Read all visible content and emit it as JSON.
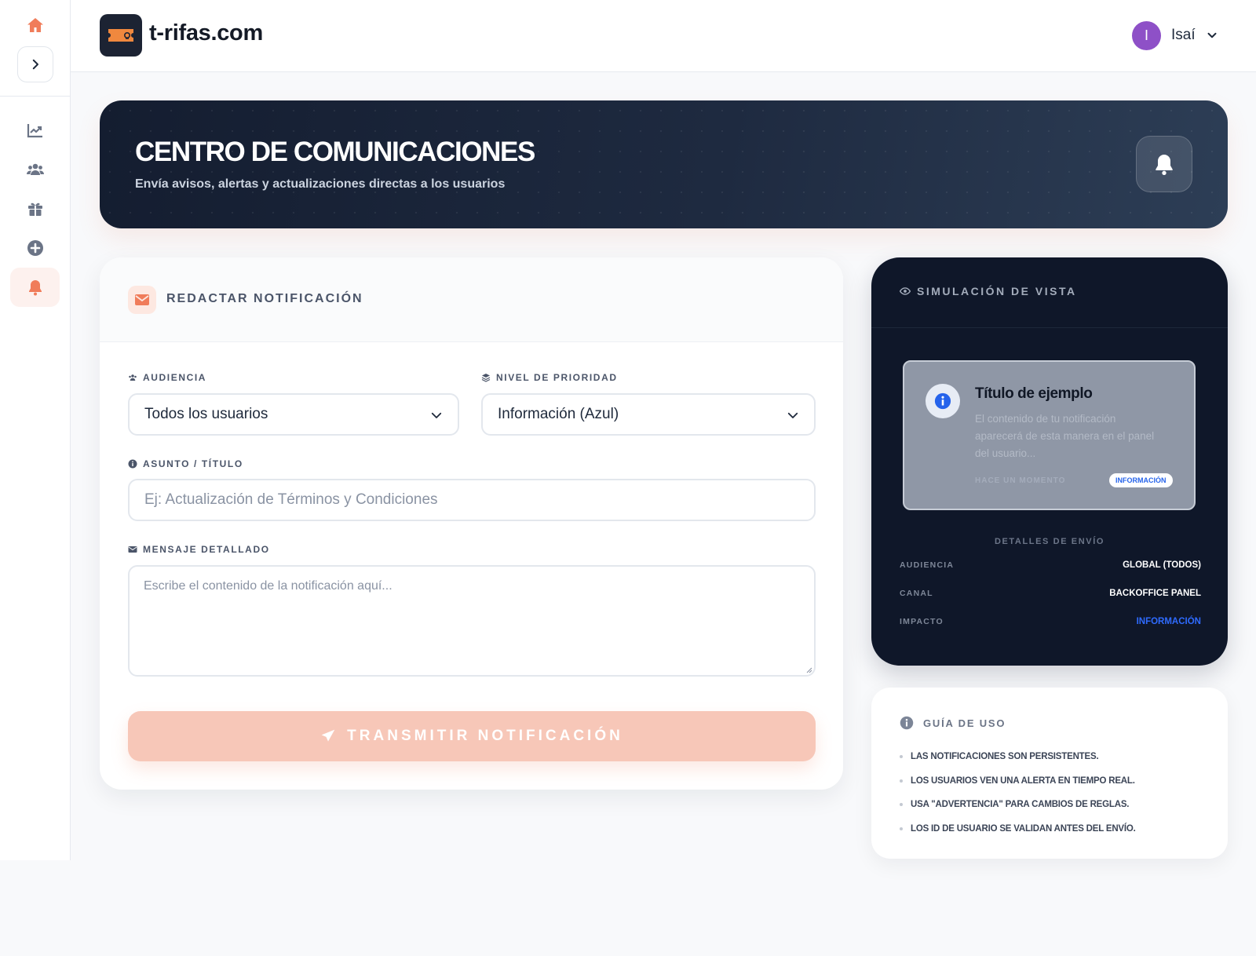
{
  "header": {
    "brand": "t-rifas.com",
    "user": {
      "initial": "I",
      "name": "Isaí"
    }
  },
  "sidebar": {
    "items": [
      {
        "name": "home",
        "icon": "home-icon"
      },
      {
        "name": "toggle",
        "icon": "chevron-right-icon"
      },
      {
        "name": "stats",
        "icon": "chart-line-icon"
      },
      {
        "name": "users",
        "icon": "users-icon"
      },
      {
        "name": "raffles",
        "icon": "gift-icon"
      },
      {
        "name": "create",
        "icon": "plus-circle-icon"
      },
      {
        "name": "notifications",
        "icon": "bell-icon",
        "active": true
      }
    ]
  },
  "hero": {
    "title": "CENTRO DE COMUNICACIONES",
    "subtitle": "Envía avisos, alertas y actualizaciones directas a los usuarios"
  },
  "compose": {
    "title": "REDACTAR NOTIFICACIÓN",
    "audience_label": "AUDIENCIA",
    "audience_value": "Todos los usuarios",
    "priority_label": "NIVEL DE PRIORIDAD",
    "priority_value": "Información (Azul)",
    "subject_label": "ASUNTO / TÍTULO",
    "subject_value": "",
    "subject_placeholder": "Ej: Actualización de Términos y Condiciones",
    "message_label": "MENSAJE DETALLADO",
    "message_value": "",
    "message_placeholder": "Escribe el contenido de la notificación aquí...",
    "submit_label": "TRANSMITIR NOTIFICACIÓN"
  },
  "preview": {
    "title": "SIMULACIÓN DE VISTA",
    "notification": {
      "title": "Título de ejemplo",
      "body": "El contenido de tu notificación aparecerá de esta manera en el panel del usuario...",
      "time": "HACE UN MOMENTO",
      "badge": "INFORMACIÓN"
    },
    "details_title": "DETALLES DE ENVÍO",
    "details": [
      {
        "key": "AUDIENCIA",
        "value": "GLOBAL (TODOS)"
      },
      {
        "key": "CANAL",
        "value": "BACKOFFICE PANEL"
      },
      {
        "key": "IMPACTO",
        "value": "INFORMACIÓN"
      }
    ]
  },
  "guide": {
    "title": "GUÍA DE USO",
    "items": [
      "LAS NOTIFICACIONES SON PERSISTENTES.",
      "LOS USUARIOS VEN UNA ALERTA EN TIEMPO REAL.",
      "USA \"ADVERTENCIA\" PARA CAMBIOS DE REGLAS.",
      "LOS ID DE USUARIO SE VALIDAN ANTES DEL ENVÍO."
    ]
  },
  "colors": {
    "accent": "#f07c5a",
    "accent_soft": "#f7c7b8",
    "navy": "#0f1729",
    "info_blue": "#2563eb",
    "avatar": "#8e50c7"
  }
}
